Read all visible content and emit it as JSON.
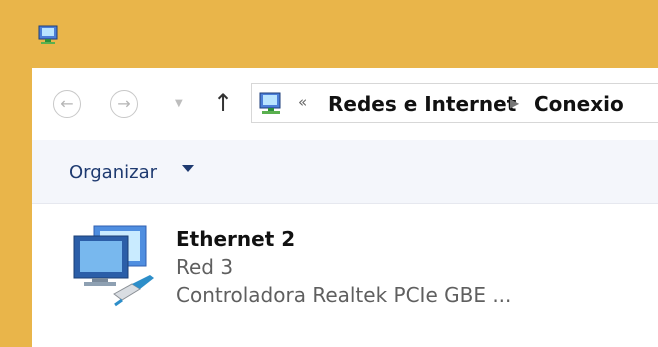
{
  "window": {
    "title_icon": "network-connections-icon"
  },
  "navigation": {
    "back_icon": "back-arrow-icon",
    "forward_icon": "forward-arrow-icon",
    "recent_icon": "chevron-down-icon",
    "up_icon": "up-arrow-icon",
    "breadcrumb_prefix": "«",
    "breadcrumb": [
      {
        "label": "Redes e Internet"
      },
      {
        "label": "Conexio"
      }
    ]
  },
  "toolbar": {
    "organize_label": "Organizar"
  },
  "connections": [
    {
      "name": "Ethernet 2",
      "network": "Red  3",
      "adapter": "Controladora Realtek PCIe GBE ..."
    }
  ],
  "colors": {
    "title_bar": "#e9b54a",
    "toolbar_bg": "#f4f6fb",
    "link_text": "#1e3a70"
  }
}
